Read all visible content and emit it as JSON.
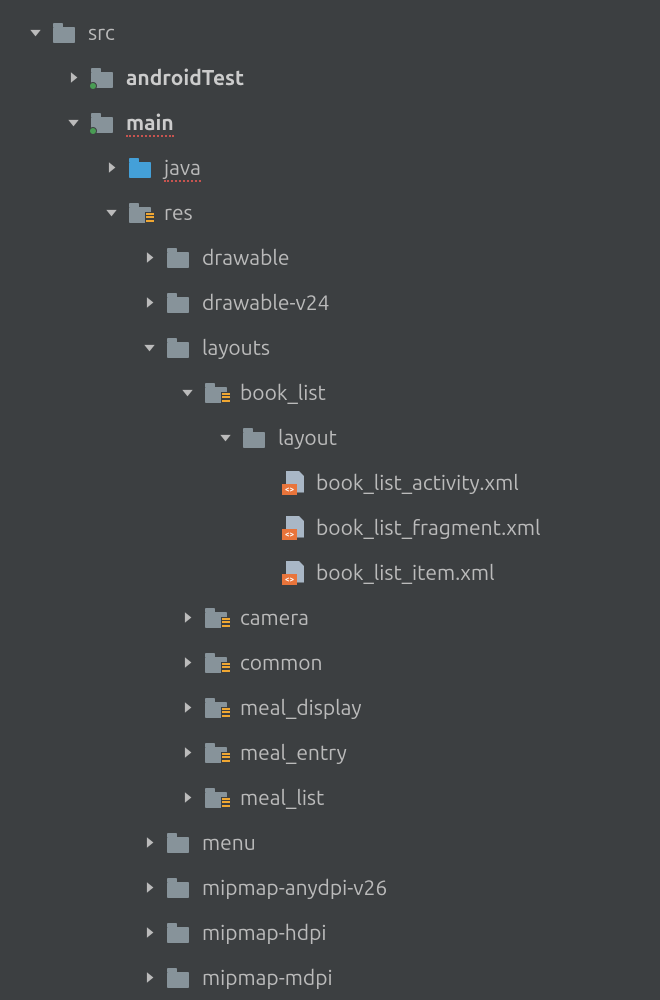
{
  "tree": [
    {
      "depth": 0,
      "arrow": "down",
      "icon": "folder",
      "label": "src",
      "bold": false,
      "underline": false
    },
    {
      "depth": 1,
      "arrow": "right",
      "icon": "folder-dot",
      "label": "androidTest",
      "bold": true,
      "underline": false
    },
    {
      "depth": 1,
      "arrow": "down",
      "icon": "folder-dot",
      "label": "main",
      "bold": true,
      "underline": true
    },
    {
      "depth": 2,
      "arrow": "right",
      "icon": "folder-blue",
      "label": "java",
      "bold": false,
      "underline": true
    },
    {
      "depth": 2,
      "arrow": "down",
      "icon": "folder-res",
      "label": "res",
      "bold": false,
      "underline": false
    },
    {
      "depth": 3,
      "arrow": "right",
      "icon": "folder",
      "label": "drawable",
      "bold": false,
      "underline": false
    },
    {
      "depth": 3,
      "arrow": "right",
      "icon": "folder",
      "label": "drawable-v24",
      "bold": false,
      "underline": false
    },
    {
      "depth": 3,
      "arrow": "down",
      "icon": "folder",
      "label": "layouts",
      "bold": false,
      "underline": false
    },
    {
      "depth": 4,
      "arrow": "down",
      "icon": "folder-res",
      "label": "book_list",
      "bold": false,
      "underline": false
    },
    {
      "depth": 5,
      "arrow": "down",
      "icon": "folder",
      "label": "layout",
      "bold": false,
      "underline": false
    },
    {
      "depth": 6,
      "arrow": "none",
      "icon": "xml",
      "label": "book_list_activity.xml",
      "bold": false,
      "underline": false
    },
    {
      "depth": 6,
      "arrow": "none",
      "icon": "xml",
      "label": "book_list_fragment.xml",
      "bold": false,
      "underline": false
    },
    {
      "depth": 6,
      "arrow": "none",
      "icon": "xml",
      "label": "book_list_item.xml",
      "bold": false,
      "underline": false
    },
    {
      "depth": 4,
      "arrow": "right",
      "icon": "folder-res",
      "label": "camera",
      "bold": false,
      "underline": false
    },
    {
      "depth": 4,
      "arrow": "right",
      "icon": "folder-res",
      "label": "common",
      "bold": false,
      "underline": false
    },
    {
      "depth": 4,
      "arrow": "right",
      "icon": "folder-res",
      "label": "meal_display",
      "bold": false,
      "underline": false
    },
    {
      "depth": 4,
      "arrow": "right",
      "icon": "folder-res",
      "label": "meal_entry",
      "bold": false,
      "underline": false
    },
    {
      "depth": 4,
      "arrow": "right",
      "icon": "folder-res",
      "label": "meal_list",
      "bold": false,
      "underline": false
    },
    {
      "depth": 3,
      "arrow": "right",
      "icon": "folder",
      "label": "menu",
      "bold": false,
      "underline": false
    },
    {
      "depth": 3,
      "arrow": "right",
      "icon": "folder",
      "label": "mipmap-anydpi-v26",
      "bold": false,
      "underline": false
    },
    {
      "depth": 3,
      "arrow": "right",
      "icon": "folder",
      "label": "mipmap-hdpi",
      "bold": false,
      "underline": false
    },
    {
      "depth": 3,
      "arrow": "right",
      "icon": "folder",
      "label": "mipmap-mdpi",
      "bold": false,
      "underline": false
    }
  ],
  "indent_base": 24,
  "indent_step": 38
}
